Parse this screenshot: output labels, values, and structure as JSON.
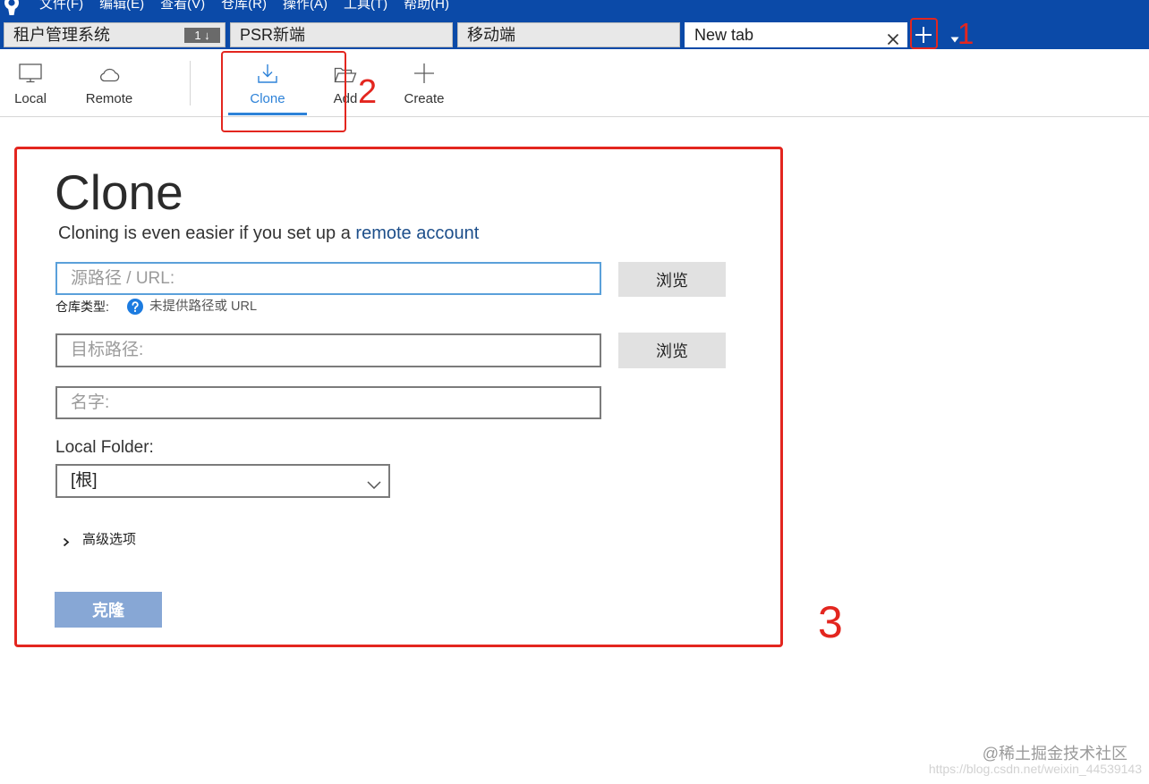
{
  "app": {
    "logo_icon": "sourcetree-logo-icon"
  },
  "menu": {
    "items": [
      "文件(F)",
      "编辑(E)",
      "查看(V)",
      "仓库(R)",
      "操作(A)",
      "工具(T)",
      "帮助(H)"
    ]
  },
  "tabs": [
    {
      "label": "租户管理系统",
      "badge": "1 ↓"
    },
    {
      "label": "PSR新端"
    },
    {
      "label": "移动端"
    },
    {
      "label": "New tab",
      "active": true,
      "close_icon": "close-icon"
    }
  ],
  "tabbar": {
    "add_icon": "plus-icon",
    "dropdown_icon": "caret-down-icon"
  },
  "toolbar": {
    "items": [
      {
        "label": "Local",
        "icon": "monitor-icon"
      },
      {
        "label": "Remote",
        "icon": "cloud-icon"
      },
      {
        "label": "Clone",
        "icon": "download-icon",
        "selected": true
      },
      {
        "label": "Add",
        "icon": "folder-open-icon"
      },
      {
        "label": "Create",
        "icon": "plus-icon"
      }
    ]
  },
  "clone_form": {
    "title": "Clone",
    "subtitle": "Cloning is even easier if you set up a",
    "subtitle_link": "remote account",
    "source_url": {
      "placeholder": "源路径 / URL:",
      "value": ""
    },
    "browse_label": "浏览",
    "repo_type_label": "仓库类型:",
    "repo_type_icon": "help-icon",
    "repo_type_status": "未提供路径或 URL",
    "destination_path": {
      "placeholder": "目标路径:",
      "value": ""
    },
    "name": {
      "placeholder": "名字:",
      "value": ""
    },
    "local_folder_label": "Local Folder:",
    "local_folder_value": "[根]",
    "advanced_icon": "chevron-right-icon",
    "advanced_label": "高级选项",
    "submit_label": "克隆"
  },
  "annotations": {
    "step_1": "1",
    "step_2": "2",
    "step_3": "3"
  },
  "watermark": {
    "juejin": "@稀土掘金技术社区",
    "csdn": "https://blog.csdn.net/weixin_44539143"
  },
  "colors": {
    "title_bar": "#0b4aa8",
    "accent": "#2d82d8",
    "link": "#1c4e8a",
    "primary_button": "#87a7d5",
    "annotation_red": "#e3261f",
    "help_icon": "#1c7be0",
    "focus_border": "#5aa0da",
    "tab_badge": "#6a6a6a"
  }
}
